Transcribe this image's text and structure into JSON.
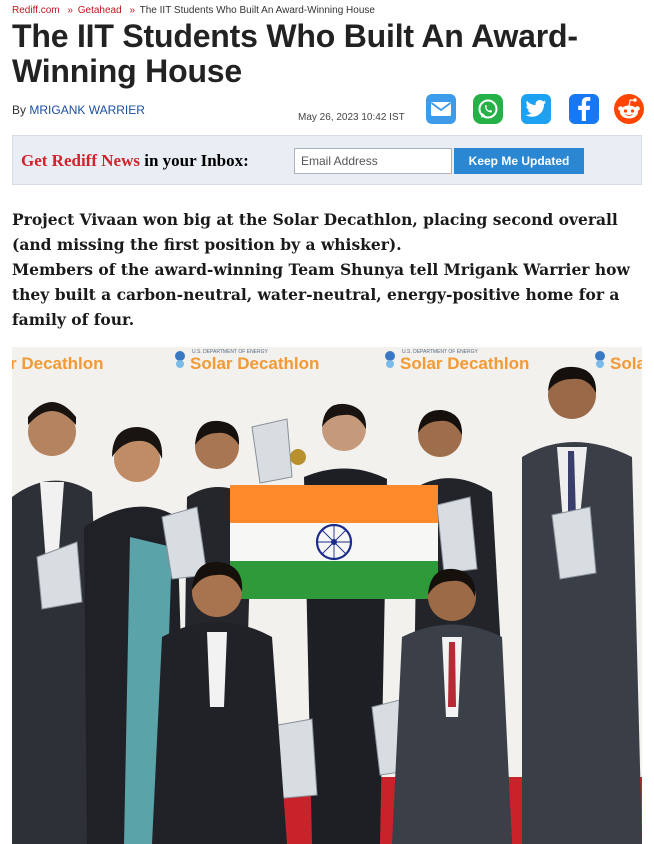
{
  "breadcrumb": {
    "home": "Rediff.com",
    "section": "Getahead",
    "current": "The IIT Students Who Built An Award-Winning House"
  },
  "article": {
    "title": "The IIT Students Who Built An Award-Winning House",
    "byline_prefix": "By",
    "author": "MRIGANK WARRIER",
    "date": "May 26, 2023 10:42 IST"
  },
  "share_icons": [
    "mail-icon",
    "whatsapp-icon",
    "twitter-icon",
    "facebook-icon",
    "reddit-icon"
  ],
  "subscribe": {
    "label_red": "Get Rediff News",
    "label_rest": " in your Inbox:",
    "email_placeholder": "Email Address",
    "button_label": "Keep Me Updated"
  },
  "intro": {
    "para1": "Project Vivaan won big at the Solar Decathlon, placing second overall (and missing the first position by a whisker).",
    "para2": "Members of the award-winning Team Shunya tell Mrigank Warrier how they built a carbon-neutral, water-neutral, energy-positive home for a family of four."
  },
  "photo": {
    "backdrop_brand": "Solar Decathlon",
    "backdrop_sponsor": "U.S. DEPARTMENT OF ENERGY",
    "backdrop_partial_left": "r Decathlon",
    "backdrop_partial_right": "Sola"
  },
  "colors": {
    "link_red": "#c4161c",
    "author_blue": "#1b4f9c",
    "button_blue": "#2b87d1",
    "flag_saffron": "#ff8a2b",
    "flag_green": "#2f9a3a",
    "chakra_navy": "#1b2b8a",
    "carpet_red": "#c8232a",
    "logo_orange": "#f39a35"
  }
}
